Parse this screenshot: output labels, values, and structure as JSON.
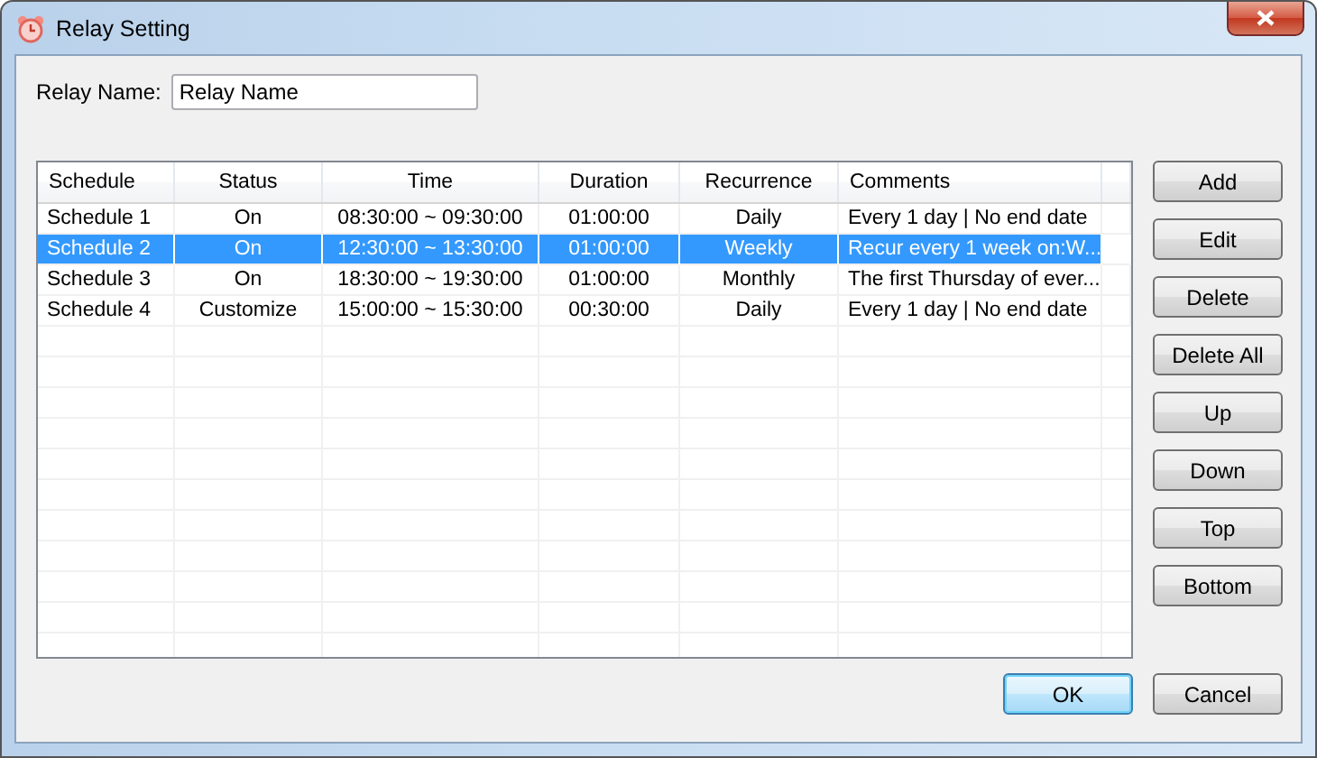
{
  "window": {
    "title": "Relay Setting"
  },
  "relay_name": {
    "label": "Relay Name:",
    "value": "Relay Name"
  },
  "table": {
    "columns": [
      "Schedule",
      "Status",
      "Time",
      "Duration",
      "Recurrence",
      "Comments"
    ],
    "rows": [
      {
        "cells": [
          "Schedule 1",
          "On",
          "08:30:00 ~ 09:30:00",
          "01:00:00",
          "Daily",
          "Every 1 day | No end date"
        ],
        "selected": false
      },
      {
        "cells": [
          "Schedule 2",
          "On",
          "12:30:00 ~ 13:30:00",
          "01:00:00",
          "Weekly",
          "Recur every 1 week on:W..."
        ],
        "selected": true
      },
      {
        "cells": [
          "Schedule 3",
          "On",
          "18:30:00 ~ 19:30:00",
          "01:00:00",
          "Monthly",
          "The first Thursday of ever..."
        ],
        "selected": false
      },
      {
        "cells": [
          "Schedule 4",
          "Customize",
          "15:00:00 ~ 15:30:00",
          "00:30:00",
          "Daily",
          "Every 1 day | No end date"
        ],
        "selected": false
      }
    ]
  },
  "side_buttons": [
    "Add",
    "Edit",
    "Delete",
    "Delete All",
    "Up",
    "Down",
    "Top",
    "Bottom"
  ],
  "dialog_buttons": [
    {
      "label": "OK",
      "default": true
    },
    {
      "label": "Cancel",
      "default": false
    }
  ]
}
